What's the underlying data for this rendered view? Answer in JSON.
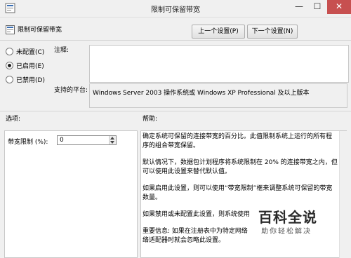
{
  "window": {
    "title": "限制可保留带宽",
    "controls": {
      "minimize": "—",
      "maximize": "☐",
      "close": "✕"
    }
  },
  "policy": {
    "name": "限制可保留带宽"
  },
  "nav": {
    "prev_label": "上一个设置(P)",
    "next_label": "下一个设置(N)"
  },
  "state": {
    "options": [
      {
        "label": "未配置(C)",
        "selected": false
      },
      {
        "label": "已启用(E)",
        "selected": true
      },
      {
        "label": "已禁用(D)",
        "selected": false
      }
    ]
  },
  "comment": {
    "label": "注释:",
    "value": ""
  },
  "platform": {
    "label": "支持的平台:",
    "value": "Windows Server 2003 操作系统或 Windows XP Professional 及以上版本"
  },
  "options_section": {
    "title": "选项:",
    "bandwidth_label": "带宽限制 (%):",
    "bandwidth_value": "0"
  },
  "help_section": {
    "title": "帮助:",
    "paragraphs": [
      "确定系统可保留的连接带宽的百分比。此值限制系统上运行的所有程序的组合带宽保留。",
      "默认情况下，数据包计划程序将系统限制在 20% 的连接带宽之内，但可以使用此设置来替代默认值。",
      "如果启用此设置，则可以使用“带宽限制”框来调整系统可保留的带宽数量。",
      "如果禁用或未配置此设置，则系统使用",
      "重要信息: 如果在注册表中为特定网络\n络适配器时就会忽略此设置。"
    ]
  },
  "watermark": {
    "main": "百科全说",
    "sub": "助你轻松解决"
  },
  "colors": {
    "close_button": "#c75050",
    "background": "#f0f0f0"
  }
}
